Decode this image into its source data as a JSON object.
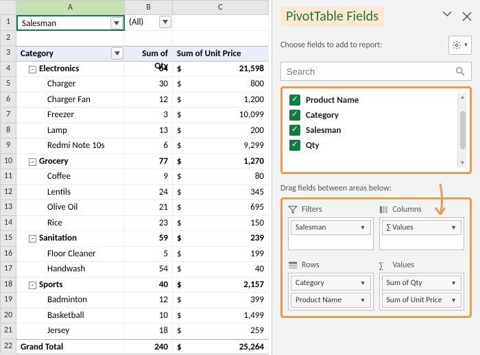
{
  "sheet": {
    "cols": [
      "",
      "A",
      "B",
      "C"
    ],
    "filter_field": "Salesman",
    "filter_value": "(All)",
    "headers": [
      "Category",
      "Sum of Qty",
      "Sum of Unit Price"
    ],
    "rows": [
      {
        "r": 4,
        "type": "cat",
        "label": "Electronics",
        "qty": "64",
        "cur": "$",
        "price": "21,598"
      },
      {
        "r": 5,
        "type": "item",
        "label": "Charger",
        "qty": "30",
        "cur": "$",
        "price": "800"
      },
      {
        "r": 6,
        "type": "item",
        "label": "Charger  Fan",
        "qty": "12",
        "cur": "$",
        "price": "1,200"
      },
      {
        "r": 7,
        "type": "item",
        "label": "Freezer",
        "qty": "3",
        "cur": "$",
        "price": "10,099"
      },
      {
        "r": 8,
        "type": "item",
        "label": "Lamp",
        "qty": "13",
        "cur": "$",
        "price": "200"
      },
      {
        "r": 9,
        "type": "item",
        "label": "Redmi Note 10s",
        "qty": "6",
        "cur": "$",
        "price": "9,299"
      },
      {
        "r": 10,
        "type": "cat",
        "label": "Grocery",
        "qty": "77",
        "cur": "$",
        "price": "1,270"
      },
      {
        "r": 11,
        "type": "item",
        "label": "Coffee",
        "qty": "9",
        "cur": "$",
        "price": "80"
      },
      {
        "r": 12,
        "type": "item",
        "label": "Lentils",
        "qty": "24",
        "cur": "$",
        "price": "345"
      },
      {
        "r": 13,
        "type": "item",
        "label": "Olive Oil",
        "qty": "21",
        "cur": "$",
        "price": "695"
      },
      {
        "r": 14,
        "type": "item",
        "label": "Rice",
        "qty": "23",
        "cur": "$",
        "price": "150"
      },
      {
        "r": 15,
        "type": "cat",
        "label": "Sanitation",
        "qty": "59",
        "cur": "$",
        "price": "239"
      },
      {
        "r": 16,
        "type": "item",
        "label": "Floor Cleaner",
        "qty": "5",
        "cur": "$",
        "price": "199"
      },
      {
        "r": 17,
        "type": "item",
        "label": "Handwash",
        "qty": "54",
        "cur": "$",
        "price": "40"
      },
      {
        "r": 18,
        "type": "cat",
        "label": "Sports",
        "qty": "40",
        "cur": "$",
        "price": "2,157"
      },
      {
        "r": 19,
        "type": "item",
        "label": "Badminton",
        "qty": "12",
        "cur": "$",
        "price": "399"
      },
      {
        "r": 20,
        "type": "item",
        "label": "Basketball",
        "qty": "10",
        "cur": "$",
        "price": "1,499"
      },
      {
        "r": 21,
        "type": "item",
        "label": "Jersey",
        "qty": "18",
        "cur": "$",
        "price": "259"
      }
    ],
    "grand_total": {
      "r": 22,
      "label": "Grand Total",
      "qty": "240",
      "cur": "$",
      "price": "25,264"
    }
  },
  "pane": {
    "title": "PivotTable Fields",
    "subtitle": "Choose fields to add to report:",
    "search_placeholder": "Search",
    "fields": [
      {
        "label": "Product Name",
        "checked": true
      },
      {
        "label": " Category",
        "checked": true
      },
      {
        "label": "Salesman",
        "checked": true
      },
      {
        "label": "Qty",
        "checked": true
      }
    ],
    "drag_label": "Drag fields between areas below:",
    "areas": {
      "filters": {
        "title": "Filters",
        "items": [
          "Salesman"
        ]
      },
      "columns": {
        "title": "Columns",
        "items": [
          "∑ Values"
        ]
      },
      "rows": {
        "title": "Rows",
        "items": [
          "Category",
          "Product Name"
        ]
      },
      "values": {
        "title": "Values",
        "items": [
          "Sum of Qty",
          "Sum of Unit Price"
        ]
      }
    }
  }
}
